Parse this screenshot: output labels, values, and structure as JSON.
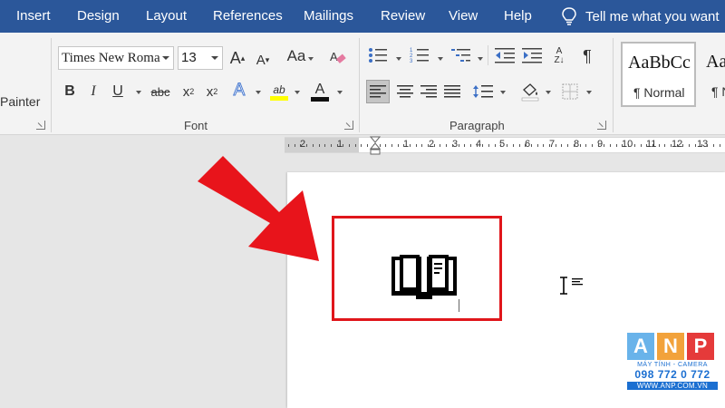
{
  "tabs": [
    "Insert",
    "Design",
    "Layout",
    "References",
    "Mailings",
    "Review",
    "View",
    "Help"
  ],
  "tell_me": "Tell me what you want",
  "clipboard": {
    "format_painter_partial": "Painter"
  },
  "font_group": {
    "font_name": "Times New Roma",
    "font_size": "13",
    "label": "Font",
    "buttons": {
      "bold": "B",
      "italic": "I",
      "underline": "U",
      "strikethrough": "abc",
      "subscript_base": "x",
      "subscript_num": "2",
      "superscript_base": "x",
      "superscript_num": "2",
      "text_effects": "A",
      "highlight": "ab",
      "font_color": "A",
      "grow": "A",
      "shrink": "A",
      "change_case": "Aa"
    }
  },
  "paragraph_group": {
    "label": "Paragraph",
    "sort": "A",
    "pilcrow": "¶"
  },
  "styles": [
    {
      "sample": "AaBbCc",
      "name": "¶ Normal"
    },
    {
      "sample": "AaB",
      "name": "¶ N"
    }
  ],
  "ruler": {
    "labels": [
      "2",
      "1",
      "1",
      "2",
      "3",
      "4",
      "5",
      "6",
      "7",
      "8",
      "9",
      "10",
      "11",
      "12",
      "13"
    ]
  },
  "watermark": {
    "letters": [
      "A",
      "N",
      "P"
    ],
    "letter_colors": [
      "#69b3ea",
      "#f2a23b",
      "#e53a3a"
    ],
    "subtitle": "MÁY TÍNH - CAMERA",
    "phone": "098 772 0 772",
    "website": "WWW.ANP.COM.VN"
  },
  "colors": {
    "ribbon_tabs": "#2b579a",
    "highlight_box": "#e0161b",
    "arrow": "#e8141b"
  }
}
